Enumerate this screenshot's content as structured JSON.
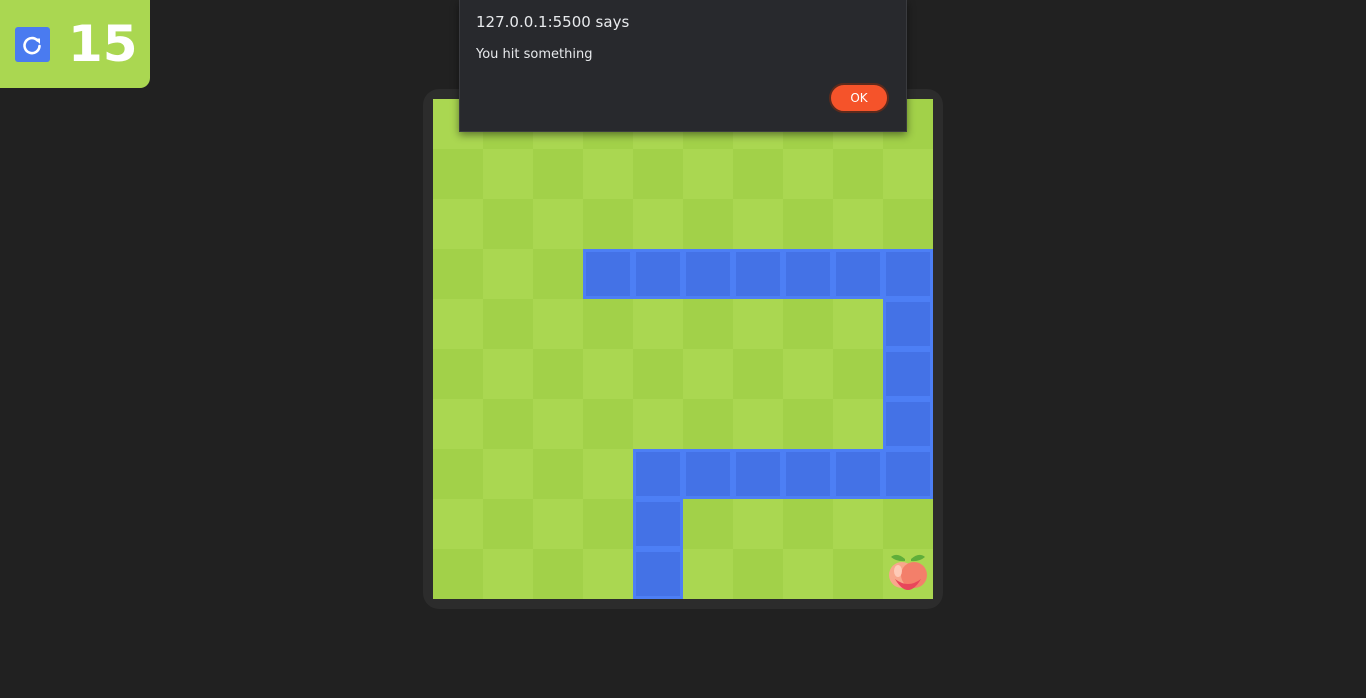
{
  "score": {
    "value": "15",
    "restart_icon": "restart-icon"
  },
  "dialog": {
    "title": "127.0.0.1:5500 says",
    "message": "You hit something",
    "ok_label": "OK"
  },
  "board": {
    "columns": 10,
    "rows": 10,
    "light_color": "#aad751",
    "dark_color": "#a2d149",
    "snake_color": "#4472e6",
    "snake_cells": [
      [
        3,
        3
      ],
      [
        4,
        3
      ],
      [
        5,
        3
      ],
      [
        6,
        3
      ],
      [
        7,
        3
      ],
      [
        8,
        3
      ],
      [
        9,
        3
      ],
      [
        9,
        4
      ],
      [
        9,
        5
      ],
      [
        9,
        6
      ],
      [
        9,
        7
      ],
      [
        8,
        7
      ],
      [
        7,
        7
      ],
      [
        6,
        7
      ],
      [
        5,
        7
      ],
      [
        4,
        7
      ],
      [
        4,
        8
      ],
      [
        4,
        9
      ]
    ],
    "fruit": {
      "type": "peach-icon",
      "cell": [
        9,
        9
      ]
    }
  }
}
